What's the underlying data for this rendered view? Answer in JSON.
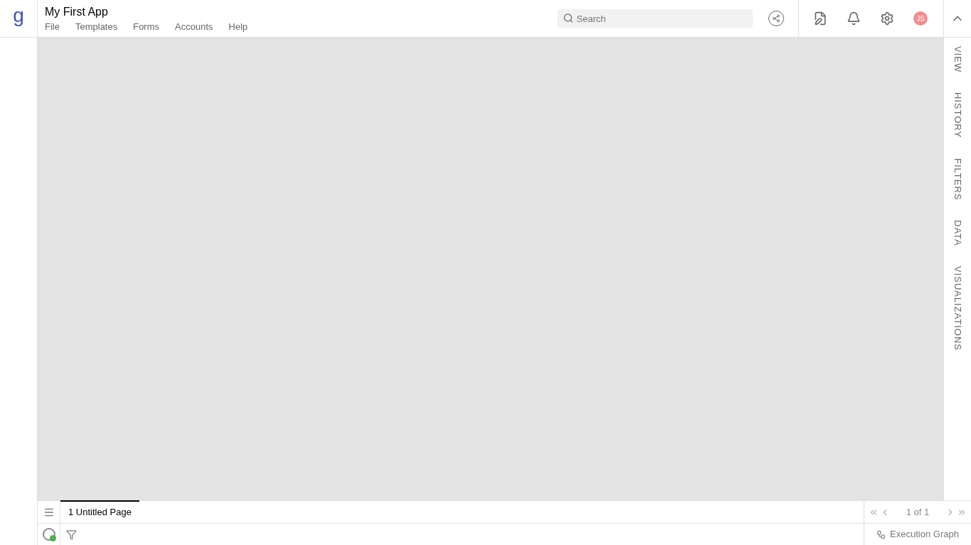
{
  "logo": {
    "letter": "g"
  },
  "app": {
    "title": "My First App"
  },
  "menu": [
    "File",
    "Templates",
    "Forms",
    "Accounts",
    "Help"
  ],
  "search": {
    "placeholder": "Search"
  },
  "user": {
    "initials": "JS"
  },
  "side_panels": [
    "VIEW",
    "HISTORY",
    "FILTERS",
    "DATA",
    "VISUALIZATIONS"
  ],
  "page_tabs": [
    {
      "label": "1 Untitled Page",
      "selected": true
    }
  ],
  "pagination": {
    "reading": "1 of 1"
  },
  "status_bar": {
    "execution_graph": "Execution Graph"
  }
}
